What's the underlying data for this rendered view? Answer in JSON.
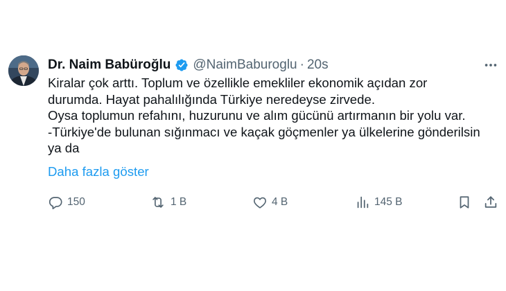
{
  "author": {
    "display_name": "Dr. Naim Babüroğlu",
    "handle": "@NaimBaburoglu",
    "separator": "·",
    "time": "20s"
  },
  "tweet": {
    "lines": [
      "Kiralar çok arttı. Toplum ve özellikle emekliler ekonomik açıdan zor",
      "durumda. Hayat pahalılığında Türkiye neredeyse zirvede.",
      "Oysa toplumun refahını, huzurunu ve alım gücünü artırmanın bir yolu var.",
      "-Türkiye'de bulunan sığınmacı ve kaçak göçmenler ya ülkelerine gönderilsin",
      "ya da"
    ],
    "show_more": "Daha fazla göster"
  },
  "actions": {
    "replies": "150",
    "reposts": "1 B",
    "likes": "4 B",
    "views": "145 B"
  },
  "icons": {
    "verified": "verified-badge-icon",
    "more": "more-icon",
    "reply": "reply-icon",
    "repost": "repost-icon",
    "like": "like-icon",
    "views": "views-icon",
    "bookmark": "bookmark-icon",
    "share": "share-icon"
  },
  "colors": {
    "text": "#0f1419",
    "secondary": "#536471",
    "link": "#1d9bf0",
    "verified": "#1d9bf0"
  }
}
